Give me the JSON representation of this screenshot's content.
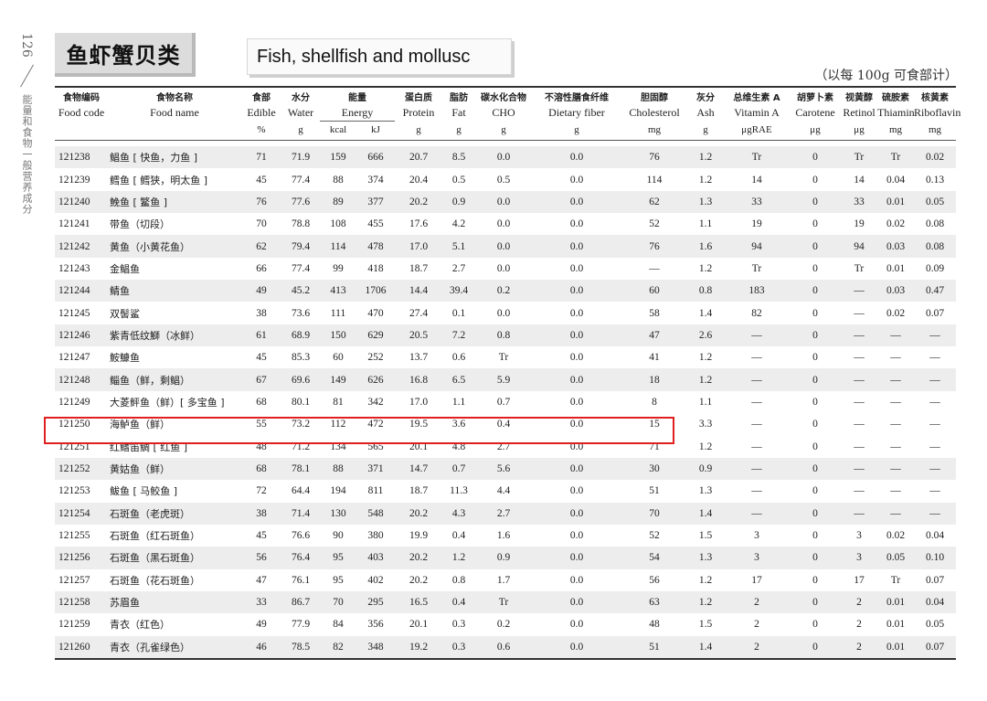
{
  "side": {
    "page_number": "126",
    "caption": "能量和食物一般营养成分"
  },
  "header": {
    "title_cn": "鱼虾蟹贝类",
    "title_en": "Fish, shellfish and mollusc",
    "unit_note": "（以每 100g 可食部计）"
  },
  "columns": [
    {
      "cn": "食物编码",
      "en": "Food code",
      "unit": ""
    },
    {
      "cn": "食物名称",
      "en": "Food name",
      "unit": ""
    },
    {
      "cn": "食部",
      "en": "Edible",
      "unit": "%"
    },
    {
      "cn": "水分",
      "en": "Water",
      "unit": "g"
    },
    {
      "cn": "能量",
      "en": "Energy",
      "sub": [
        "kcal",
        "kJ"
      ]
    },
    {
      "cn": "蛋白质",
      "en": "Protein",
      "unit": "g"
    },
    {
      "cn": "脂肪",
      "en": "Fat",
      "unit": "g"
    },
    {
      "cn": "碳水化合物",
      "en": "CHO",
      "unit": "g"
    },
    {
      "cn": "不溶性膳食纤维",
      "en": "Dietary fiber",
      "unit": "g"
    },
    {
      "cn": "胆固醇",
      "en": "Cholesterol",
      "unit": "mg"
    },
    {
      "cn": "灰分",
      "en": "Ash",
      "unit": "g"
    },
    {
      "cn": "总维生素 A",
      "en": "Vitamin A",
      "unit": "μgRAE"
    },
    {
      "cn": "胡萝卜素",
      "en": "Carotene",
      "unit": "μg"
    },
    {
      "cn": "视黄醇",
      "en": "Retinol",
      "unit": "μg"
    },
    {
      "cn": "硫胺素",
      "en": "Thiamin",
      "unit": "mg"
    },
    {
      "cn": "核黄素",
      "en": "Riboflavin",
      "unit": "mg"
    }
  ],
  "rows": [
    [
      "121238",
      "鲳鱼 [ 快鱼，力鱼 ]",
      "71",
      "71.9",
      "159",
      "666",
      "20.7",
      "8.5",
      "0.0",
      "0.0",
      "76",
      "1.2",
      "Tr",
      "0",
      "Tr",
      "Tr",
      "0.02"
    ],
    [
      "121239",
      "鳕鱼 [ 鳕狭，明太鱼 ]",
      "45",
      "77.4",
      "88",
      "374",
      "20.4",
      "0.5",
      "0.5",
      "0.0",
      "114",
      "1.2",
      "14",
      "0",
      "14",
      "0.04",
      "0.13"
    ],
    [
      "121240",
      "鮸鱼 [ 鳘鱼 ]",
      "76",
      "77.6",
      "89",
      "377",
      "20.2",
      "0.9",
      "0.0",
      "0.0",
      "62",
      "1.3",
      "33",
      "0",
      "33",
      "0.01",
      "0.05"
    ],
    [
      "121241",
      "带鱼（切段）",
      "70",
      "78.8",
      "108",
      "455",
      "17.6",
      "4.2",
      "0.0",
      "0.0",
      "52",
      "1.1",
      "19",
      "0",
      "19",
      "0.02",
      "0.08"
    ],
    [
      "121242",
      "黄鱼（小黄花鱼）",
      "62",
      "79.4",
      "114",
      "478",
      "17.0",
      "5.1",
      "0.0",
      "0.0",
      "76",
      "1.6",
      "94",
      "0",
      "94",
      "0.03",
      "0.08"
    ],
    [
      "121243",
      "金鲳鱼",
      "66",
      "77.4",
      "99",
      "418",
      "18.7",
      "2.7",
      "0.0",
      "0.0",
      "—",
      "1.2",
      "Tr",
      "0",
      "Tr",
      "0.01",
      "0.09"
    ],
    [
      "121244",
      "鲭鱼",
      "49",
      "45.2",
      "413",
      "1706",
      "14.4",
      "39.4",
      "0.2",
      "0.0",
      "60",
      "0.8",
      "183",
      "0",
      "—",
      "0.03",
      "0.47"
    ],
    [
      "121245",
      "双髻鲨",
      "38",
      "73.6",
      "111",
      "470",
      "27.4",
      "0.1",
      "0.0",
      "0.0",
      "58",
      "1.4",
      "82",
      "0",
      "—",
      "0.02",
      "0.07"
    ],
    [
      "121246",
      "紫青低纹鰤（冰鲜）",
      "61",
      "68.9",
      "150",
      "629",
      "20.5",
      "7.2",
      "0.8",
      "0.0",
      "47",
      "2.6",
      "—",
      "0",
      "—",
      "—",
      "—"
    ],
    [
      "121247",
      "鮟鱇鱼",
      "45",
      "85.3",
      "60",
      "252",
      "13.7",
      "0.6",
      "Tr",
      "0.0",
      "41",
      "1.2",
      "—",
      "0",
      "—",
      "—",
      "—"
    ],
    [
      "121248",
      "鲻鱼（鲜，剩鲳）",
      "67",
      "69.6",
      "149",
      "626",
      "16.8",
      "6.5",
      "5.9",
      "0.0",
      "18",
      "1.2",
      "—",
      "0",
      "—",
      "—",
      "—"
    ],
    [
      "121249",
      "大菱鲆鱼（鲜）[ 多宝鱼 ]",
      "68",
      "80.1",
      "81",
      "342",
      "17.0",
      "1.1",
      "0.7",
      "0.0",
      "8",
      "1.1",
      "—",
      "0",
      "—",
      "—",
      "—"
    ],
    [
      "121250",
      "海鲈鱼（鲜）",
      "55",
      "73.2",
      "112",
      "472",
      "19.5",
      "3.6",
      "0.4",
      "0.0",
      "15",
      "3.3",
      "—",
      "0",
      "—",
      "—",
      "—"
    ],
    [
      "121251",
      "红鳍笛鲷 [ 红鱼 ]",
      "48",
      "71.2",
      "134",
      "565",
      "20.1",
      "4.8",
      "2.7",
      "0.0",
      "71",
      "1.2",
      "—",
      "0",
      "—",
      "—",
      "—"
    ],
    [
      "121252",
      "黄姑鱼（鲜）",
      "68",
      "78.1",
      "88",
      "371",
      "14.7",
      "0.7",
      "5.6",
      "0.0",
      "30",
      "0.9",
      "—",
      "0",
      "—",
      "—",
      "—"
    ],
    [
      "121253",
      "鲅鱼 [ 马鲛鱼 ]",
      "72",
      "64.4",
      "194",
      "811",
      "18.7",
      "11.3",
      "4.4",
      "0.0",
      "51",
      "1.3",
      "—",
      "0",
      "—",
      "—",
      "—"
    ],
    [
      "121254",
      "石斑鱼（老虎斑）",
      "38",
      "71.4",
      "130",
      "548",
      "20.2",
      "4.3",
      "2.7",
      "0.0",
      "70",
      "1.4",
      "—",
      "0",
      "—",
      "—",
      "—"
    ],
    [
      "121255",
      "石斑鱼（红石斑鱼）",
      "45",
      "76.6",
      "90",
      "380",
      "19.9",
      "0.4",
      "1.6",
      "0.0",
      "52",
      "1.5",
      "3",
      "0",
      "3",
      "0.02",
      "0.04"
    ],
    [
      "121256",
      "石斑鱼（黑石斑鱼）",
      "56",
      "76.4",
      "95",
      "403",
      "20.2",
      "1.2",
      "0.9",
      "0.0",
      "54",
      "1.3",
      "3",
      "0",
      "3",
      "0.05",
      "0.10"
    ],
    [
      "121257",
      "石斑鱼（花石斑鱼）",
      "47",
      "76.1",
      "95",
      "402",
      "20.2",
      "0.8",
      "1.7",
      "0.0",
      "56",
      "1.2",
      "17",
      "0",
      "17",
      "Tr",
      "0.07"
    ],
    [
      "121258",
      "苏眉鱼",
      "33",
      "86.7",
      "70",
      "295",
      "16.5",
      "0.4",
      "Tr",
      "0.0",
      "63",
      "1.2",
      "2",
      "0",
      "2",
      "0.01",
      "0.04"
    ],
    [
      "121259",
      "青衣（红色）",
      "49",
      "77.9",
      "84",
      "356",
      "20.1",
      "0.3",
      "0.2",
      "0.0",
      "48",
      "1.5",
      "2",
      "0",
      "2",
      "0.01",
      "0.05"
    ],
    [
      "121260",
      "青衣（孔雀绿色）",
      "46",
      "78.5",
      "82",
      "348",
      "19.2",
      "0.3",
      "0.6",
      "0.0",
      "51",
      "1.4",
      "2",
      "0",
      "2",
      "0.01",
      "0.07"
    ]
  ],
  "highlight": {
    "row_index": 12,
    "color": "#e02020"
  },
  "colors": {
    "header_box": "#dcdcdc",
    "stripe": "#ededed"
  }
}
